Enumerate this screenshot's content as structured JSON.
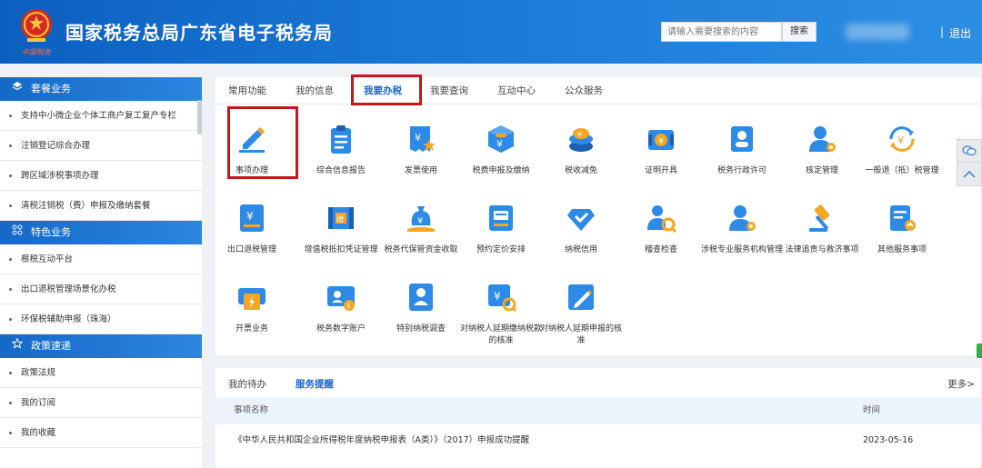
{
  "header": {
    "title": "国家税务总局广东省电子税务局",
    "emblem_caption": "中国税务",
    "search_placeholder": "请输入需要搜索的内容",
    "search_button": "搜索",
    "separator": "|",
    "logout": "退出"
  },
  "sidebar": {
    "sections": [
      {
        "title": "套餐业务",
        "icon": "layers-icon",
        "items": [
          "支持中小微企业个体工商户复工复产专栏",
          "注销登记综合办理",
          "跨区域涉税事项办理",
          "清税注销税（费）申报及缴纳套餐"
        ]
      },
      {
        "title": "特色业务",
        "icon": "grid-icon",
        "items": [
          "根税互动平台",
          "出口退税管理场景化办税",
          "环保税辅助申报（珠海）"
        ]
      },
      {
        "title": "政策速递",
        "icon": "star-icon",
        "items": [
          "政策法规",
          "我的订阅",
          "我的收藏"
        ]
      }
    ]
  },
  "tabs": [
    "常用功能",
    "我的信息",
    "我要办税",
    "我要查询",
    "互动中心",
    "公众服务"
  ],
  "active_tab": "我要办税",
  "functions": [
    {
      "label": "事项办理",
      "icon": "pen-edit-icon"
    },
    {
      "label": "综合信息报告",
      "icon": "clipboard-icon"
    },
    {
      "label": "发票使用",
      "icon": "invoice-icon"
    },
    {
      "label": "税费申报及缴纳",
      "icon": "tax-declare-icon"
    },
    {
      "label": "税收减免",
      "icon": "coins-icon"
    },
    {
      "label": "证明开具",
      "icon": "certificate-icon"
    },
    {
      "label": "税务行政许可",
      "icon": "license-icon"
    },
    {
      "label": "核定管理",
      "icon": "user-gear-icon"
    },
    {
      "label": "一般退（抵）税管理",
      "icon": "refund-icon"
    },
    {
      "label": "出口退税管理",
      "icon": "export-refund-icon"
    },
    {
      "label": "增值税抵扣凭证管理",
      "icon": "vat-voucher-icon"
    },
    {
      "label": "税务代保管资金收取",
      "icon": "money-bag-icon"
    },
    {
      "label": "预约定价安排",
      "icon": "pricing-doc-icon"
    },
    {
      "label": "纳税信用",
      "icon": "credit-diamond-icon"
    },
    {
      "label": "稽查检查",
      "icon": "inspect-icon"
    },
    {
      "label": "涉税专业服务机构管理",
      "icon": "agency-icon"
    },
    {
      "label": "法律追责与救济事项",
      "icon": "gavel-icon"
    },
    {
      "label": "其他服务事项",
      "icon": "other-service-icon"
    },
    {
      "label": "开票业务",
      "icon": "invoicing-icon"
    },
    {
      "label": "税务数字账户",
      "icon": "digital-account-icon"
    },
    {
      "label": "特别纳税调查",
      "icon": "special-investigation-icon"
    },
    {
      "label": "对纳税人延期缴纳税款的核准",
      "icon": "defer-payment-icon"
    },
    {
      "label": "对纳税人延期申报的核准",
      "icon": "defer-declare-icon"
    }
  ],
  "bottom": {
    "tabs": [
      "我的待办",
      "服务提醒"
    ],
    "active_tab": "服务提醒",
    "more": "更多>",
    "columns": [
      "事项名称",
      "时间"
    ],
    "rows": [
      {
        "name": "《中华人民共和国企业所得税年度纳税申报表（A类）》（2017）申报成功提醒",
        "time": "2023-05-16"
      }
    ]
  },
  "colors": {
    "brand_blue": "#1567c9",
    "highlight_red": "#c4161c",
    "icon_blue": "#2d8ae6",
    "icon_orange": "#f5a623"
  }
}
